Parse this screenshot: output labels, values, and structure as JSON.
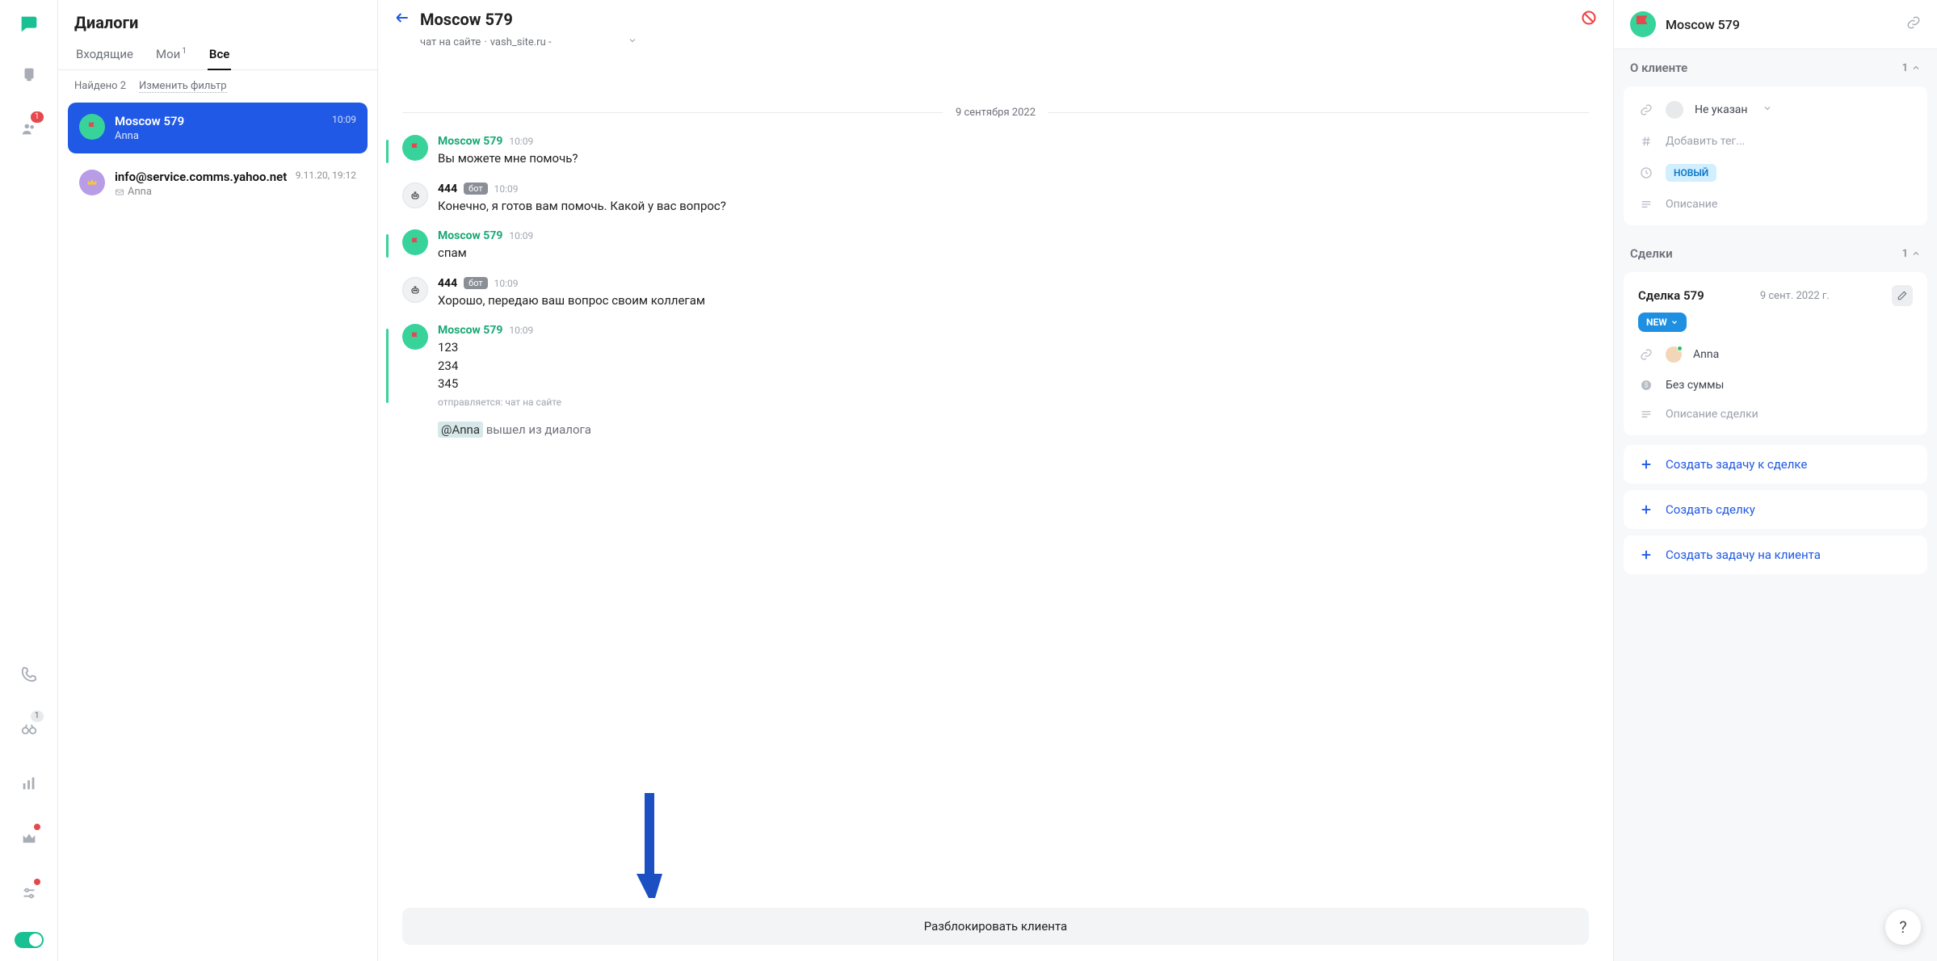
{
  "nav": {
    "visitors_badge": "1",
    "binoc_badge": "1"
  },
  "dialogs": {
    "title": "Диалоги",
    "tabs": {
      "inbox": "Входящие",
      "mine": "Мои",
      "mine_badge": "1",
      "all": "Все"
    },
    "found": "Найдено 2",
    "filter": "Изменить фильтр",
    "items": [
      {
        "title": "Moscow 579",
        "time": "10:09",
        "subtitle": "Anna"
      },
      {
        "title": "info@service.comms.yahoo.net",
        "time": "9.11.20, 19:12",
        "subtitle": "Anna"
      }
    ]
  },
  "chat": {
    "title": "Moscow 579",
    "sub_prefix": "чат на сайте",
    "sub_site": "vash_site.ru -",
    "date": "9 сентября 2022",
    "messages": [
      {
        "who": "visitor",
        "name": "Moscow 579",
        "time": "10:09",
        "text": "Вы можете мне помочь?"
      },
      {
        "who": "bot",
        "name": "444",
        "time": "10:09",
        "text": "Конечно, я готов вам помочь. Какой у вас вопрос?"
      },
      {
        "who": "visitor",
        "name": "Moscow 579",
        "time": "10:09",
        "text": "спам"
      },
      {
        "who": "bot",
        "name": "444",
        "time": "10:09",
        "text": "Хорошо, передаю ваш вопрос своим коллегам"
      },
      {
        "who": "visitor",
        "name": "Moscow 579",
        "time": "10:09",
        "text": "123\n234\n345",
        "meta": "отправляется: чат на сайте"
      }
    ],
    "bot_label": "бот",
    "left_mention": "@Anna",
    "left_text": "вышел из диалога",
    "unblock": "Разблокировать клиента"
  },
  "rpanel": {
    "client_name": "Moscow 579",
    "about_title": "О клиенте",
    "about_count": "1",
    "owner_none": "Не указан",
    "tag_placeholder": "Добавить тег...",
    "status": "НОВЫЙ",
    "desc_placeholder": "Описание",
    "deals_title": "Сделки",
    "deals_count": "1",
    "deal": {
      "title": "Сделка 579",
      "date": "9 сент. 2022 г.",
      "stage": "NEW",
      "assignee": "Anna",
      "sum": "Без суммы",
      "desc_placeholder": "Описание сделки"
    },
    "actions": {
      "task_deal": "Создать задачу к сделке",
      "create_deal": "Создать сделку",
      "task_client": "Создать задачу на клиента"
    }
  },
  "help": "?"
}
